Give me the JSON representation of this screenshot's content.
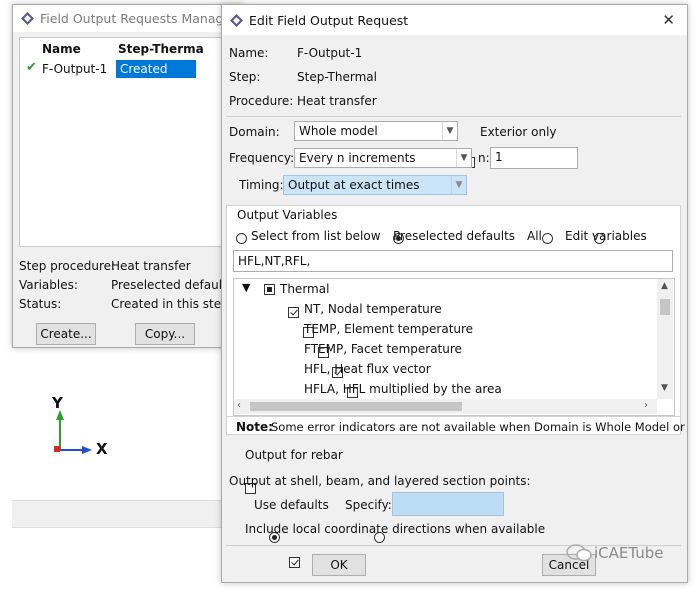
{
  "manager": {
    "title": "Field Output Requests Manager",
    "col_name": "Name",
    "col_step": "Step-Therma",
    "row_name": "F-Output-1",
    "row_status": "Created",
    "step_procedure_label": "Step procedure:",
    "step_procedure_value": "Heat transfer",
    "variables_label": "Variables:",
    "variables_value": "Preselected defaults",
    "status_label": "Status:",
    "status_value": "Created in this step",
    "create_button": "Create...",
    "copy_button": "Copy..."
  },
  "triad": {
    "y_label": "Y",
    "x_label": "X"
  },
  "dialog": {
    "title": "Edit Field Output Request",
    "name_label": "Name:",
    "name_value": "F-Output-1",
    "step_label": "Step:",
    "step_value": "Step-Thermal",
    "procedure_label": "Procedure:",
    "procedure_value": "Heat transfer",
    "domain_label": "Domain:",
    "domain_value": "Whole model",
    "exterior_only_label": "Exterior only",
    "frequency_label": "Frequency:",
    "frequency_value": "Every n increments",
    "n_label": "n:",
    "n_value": "1",
    "timing_label": "Timing:",
    "timing_value": "Output at exact times",
    "output_variables_title": "Output Variables",
    "radio_select_list": "Select from list below",
    "radio_preselected": "Preselected defaults",
    "radio_all": "All",
    "radio_edit": "Edit variables",
    "variables_text": "HFL,NT,RFL,",
    "tree_group": "Thermal",
    "tree_items": [
      {
        "label": "NT, Nodal temperature",
        "checked": true
      },
      {
        "label": "TEMP, Element temperature",
        "checked": false
      },
      {
        "label": "FTEMP, Facet temperature",
        "checked": false
      },
      {
        "label": "HFL, Heat flux vector",
        "checked": true
      },
      {
        "label": "HFLA, HFL multiplied by the area",
        "checked": false
      }
    ],
    "note_bold": "Note:",
    "note_text": "Some error indicators are not available when Domain is Whole Model or",
    "rebar_label": "Output for rebar",
    "section_points_label": "Output at shell, beam, and layered section points:",
    "use_defaults_label": "Use defaults",
    "specify_label": "Specify:",
    "local_coord_label": "Include local coordinate directions when available",
    "ok_button": "OK",
    "cancel_button": "Cancel"
  },
  "watermark": "iCAETube",
  "colors": {
    "selection": "#0078d7",
    "timing_bg": "#cce4f7",
    "specify_bg": "#bcdcf4"
  }
}
